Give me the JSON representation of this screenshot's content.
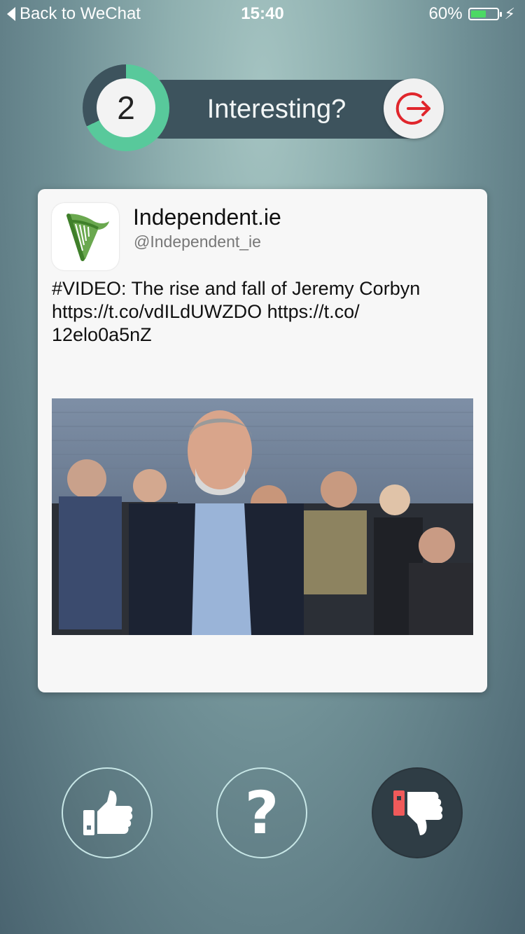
{
  "status_bar": {
    "back_label": "Back to WeChat",
    "time": "15:40",
    "battery_percent": "60%",
    "battery_level": 0.6,
    "battery_color": "#4cd964"
  },
  "header": {
    "count": "2",
    "progress": 0.68,
    "title": "Interesting?",
    "accent_color": "#58c99b",
    "exit_icon": "exit-icon",
    "exit_color": "#e0262c"
  },
  "card": {
    "account_name": "Independent.ie",
    "account_handle": "@Independent_ie",
    "logo_icon": "harp-logo",
    "tweet_lines": [
      "#VIDEO: The rise and fall of Jeremy Corbyn",
      "https://t.co/vdILdUWZDO https://t.co/",
      "12elo0a5nZ"
    ],
    "media": "tweet-photo"
  },
  "actions": {
    "like_icon": "thumbs-up-icon",
    "question_label": "?",
    "dislike_icon": "thumbs-down-icon",
    "dislike_accent": "#f05a5a"
  }
}
